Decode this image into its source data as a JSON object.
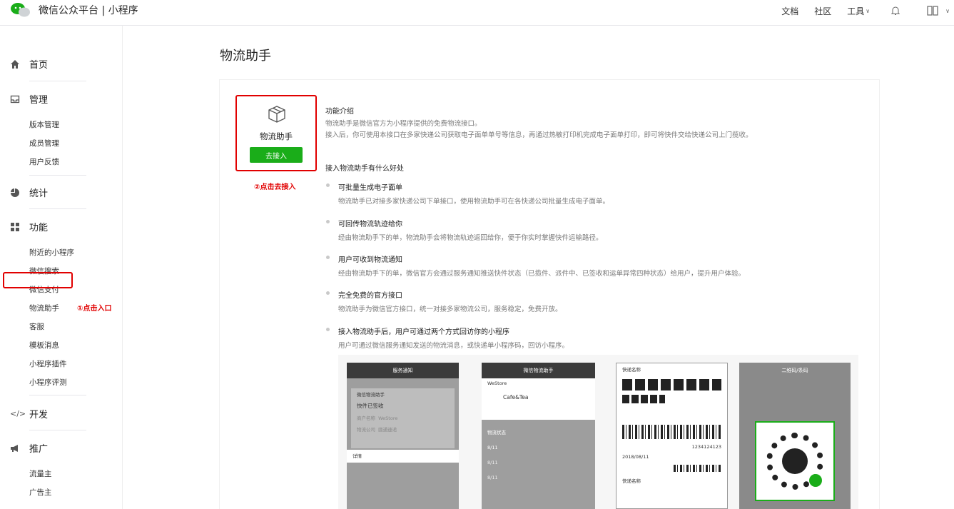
{
  "topbar": {
    "brand": "微信公众平台 | 小程序",
    "nav": {
      "docs": "文档",
      "community": "社区",
      "tools": "工具"
    }
  },
  "sidebar": {
    "home": "首页",
    "manage": "管理",
    "manage_items": [
      "版本管理",
      "成员管理",
      "用户反馈"
    ],
    "stats": "统计",
    "features": "功能",
    "feature_items": [
      "附近的小程序",
      "微信搜索",
      "微信支付",
      "物流助手",
      "客服",
      "模板消息",
      "小程序插件",
      "小程序评测"
    ],
    "dev": "开发",
    "promo": "推广",
    "promo_items": [
      "流量主",
      "广告主"
    ],
    "annotation": "①点击入口"
  },
  "main": {
    "page_title": "物流助手",
    "plugin": {
      "name": "物流助手",
      "button": "去接入",
      "annotation": "②点击去接入"
    },
    "intro_title": "功能介绍",
    "intro_line1": "物流助手是微信官方为小程序提供的免费物流接口。",
    "intro_line2": "接入后，你可使用本接口在多家快递公司获取电子面单单号等信息，再通过热敏打印机完成电子面单打印，即可将快件交给快递公司上门揽收。",
    "benefits_title": "接入物流助手有什么好处",
    "benefits": [
      {
        "title": "可批量生成电子面单",
        "desc": "物流助手已对接多家快递公司下单接口，使用物流助手可在各快递公司批量生成电子面单。"
      },
      {
        "title": "可回传物流轨迹给你",
        "desc": "经由物流助手下的单，物流助手会将物流轨迹返回给你，便于你实时掌握快件运输路径。"
      },
      {
        "title": "用户可收到物流通知",
        "desc": "经由物流助手下的单，微信官方会通过服务通知推送快件状态（已揽件、派件中、已签收和运单异常四种状态）给用户，提升用户体验。"
      },
      {
        "title": "完全免费的官方接口",
        "desc": "物流助手为微信官方接口，统一对接多家物流公司，服务稳定，免费开放。"
      },
      {
        "title": "接入物流助手后，用户可通过两个方式回访你的小程序",
        "desc": "用户可通过微信服务通知发送的物流消息，或快递单小程序码，回访小程序。"
      }
    ],
    "shots": {
      "s1_title": "服务通知",
      "s1_from": "微信物流助手",
      "s1_status": "快件已签收",
      "s1_merchant_label": "商户名称",
      "s1_merchant": "WeStore",
      "s1_courier_label": "物流公司",
      "s1_courier": "圆通速递",
      "s1_detail": "详情",
      "s2_title": "微信物流助手",
      "s2_store": "WeStore",
      "s2_item": "Cafe&Tea",
      "s2_section": "物流状态",
      "s2_date1": "8/11",
      "s2_date2": "8/11",
      "s2_date3": "8/11",
      "s3_label": "快递名称",
      "s3_num": "1234124123",
      "s3_date": "2018/08/11",
      "s3_label2": "快递名称",
      "s4_title": "二维码/条码"
    }
  }
}
